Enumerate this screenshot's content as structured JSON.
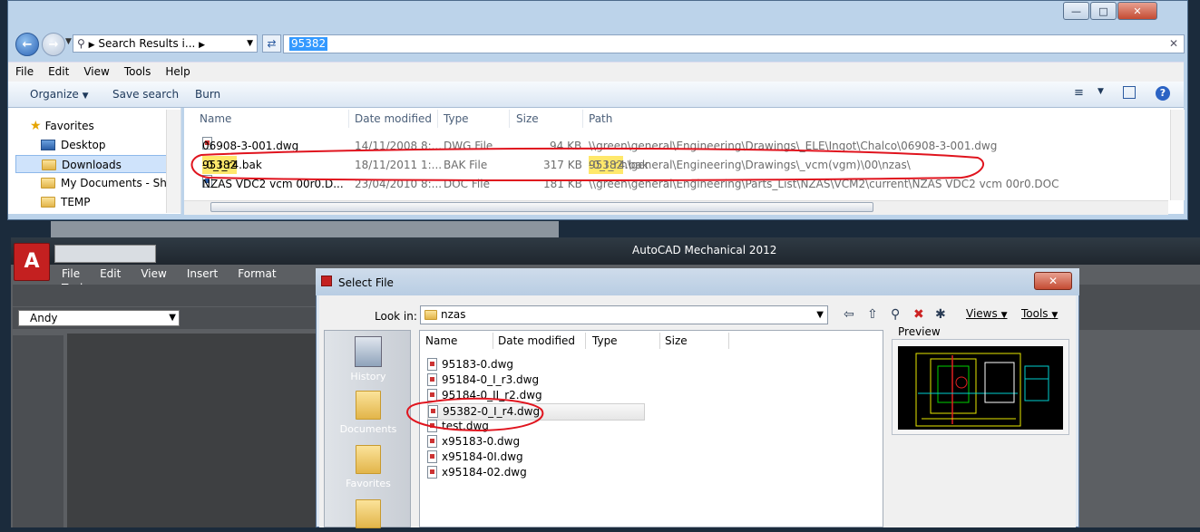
{
  "explorer": {
    "address": "Search Results i...",
    "search_value": "95382",
    "menu": [
      "File",
      "Edit",
      "View",
      "Tools",
      "Help"
    ],
    "commands": [
      "Organize",
      "Save search",
      "Burn"
    ],
    "nav": {
      "favorites": "Favorites",
      "items": [
        "Desktop",
        "Downloads",
        "My Documents - Shor",
        "TEMP"
      ]
    },
    "columns": [
      "Name",
      "Date modified",
      "Type",
      "Size",
      "Path"
    ],
    "rows": [
      {
        "name": "06908-3-001.dwg",
        "date": "14/11/2008 8:...",
        "type": "DWG File",
        "size": "94 KB",
        "path": "\\\\green\\general\\Engineering\\Drawings\\_ELE\\Ingot\\Chalco\\06908-3-001.dwg"
      },
      {
        "name_hl": "95382",
        "name_rest": "-0_I_r4.bak",
        "date": "18/11/2011 1:...",
        "type": "BAK File",
        "size": "317 KB",
        "path_pre": "\\\\green\\general\\Engineering\\Drawings\\_vcm(vgm)\\00\\nzas\\",
        "path_hl": "95382",
        "path_post": "-0_I_r4.bak"
      },
      {
        "name": "NZAS VDC2 vcm 00r0.D...",
        "date": "23/04/2010 8:...",
        "type": "DOC File",
        "size": "181 KB",
        "path": "\\\\green\\general\\Engineering\\Parts_List\\NZAS\\VCM2\\current\\NZAS VDC2 vcm 00r0.DOC"
      }
    ]
  },
  "acad": {
    "title": "AutoCAD Mechanical 2012",
    "menu": [
      "File",
      "Edit",
      "View",
      "Insert",
      "Format",
      "Tool"
    ],
    "layer": "Andy"
  },
  "dialog": {
    "title": "Select File",
    "lookin_label": "Look in:",
    "lookin_value": "nzas",
    "views": "Views",
    "tools": "Tools",
    "places": [
      "History",
      "Documents",
      "Favorites"
    ],
    "columns": [
      "Name",
      "Date modified",
      "Type",
      "Size"
    ],
    "files": [
      "95183-0.dwg",
      "95184-0_I_r3.dwg",
      "95184-0_II_r2.dwg",
      "95382-0_I_r4.dwg",
      "test.dwg",
      "x95183-0.dwg",
      "x95184-0I.dwg",
      "x95184-02.dwg"
    ],
    "preview_label": "Preview"
  },
  "colors": {
    "annotation": "#e0141e",
    "highlight": "#ffe86b",
    "selection": "#3399ff"
  }
}
